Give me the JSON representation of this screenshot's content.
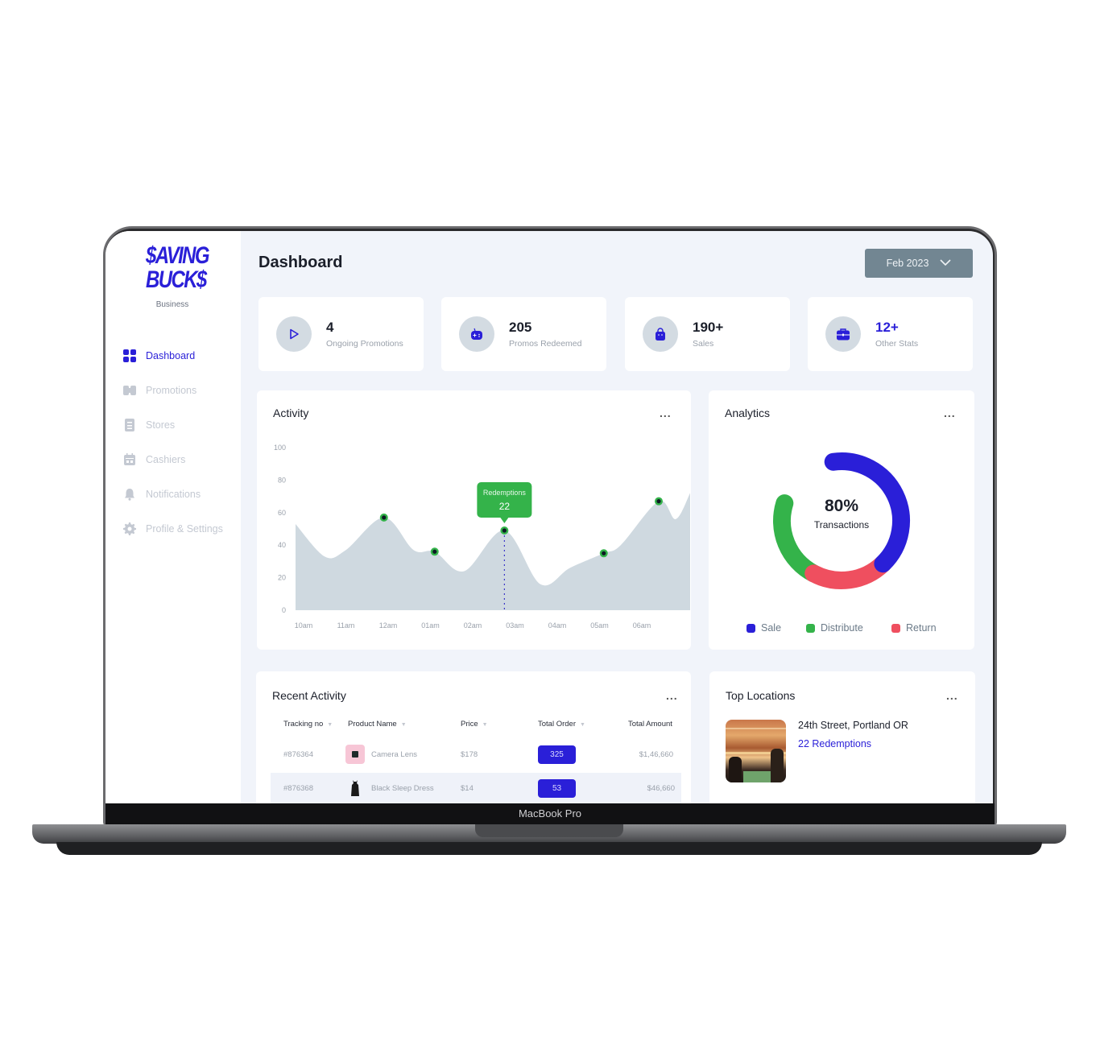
{
  "device": {
    "label": "MacBook Pro"
  },
  "brand": {
    "line1": "$AVING",
    "line2": "BUCK$",
    "subtitle": "Business",
    "color": "#2a1fd8"
  },
  "sidebar": {
    "items": [
      {
        "label": "Dashboard",
        "icon": "grid-icon",
        "active": true
      },
      {
        "label": "Promotions",
        "icon": "promotions-icon",
        "active": false
      },
      {
        "label": "Stores",
        "icon": "stores-icon",
        "active": false
      },
      {
        "label": "Cashiers",
        "icon": "calendar-icon",
        "active": false
      },
      {
        "label": "Notifications",
        "icon": "bell-icon",
        "active": false
      },
      {
        "label": "Profile & Settings",
        "icon": "gear-icon",
        "active": false
      }
    ]
  },
  "header": {
    "title": "Dashboard",
    "date_select": "Feb 2023"
  },
  "stats": [
    {
      "value": "4",
      "label": "Ongoing Promotions",
      "icon": "play-icon"
    },
    {
      "value": "205",
      "label": "Promos Redeemed",
      "icon": "gamepad-icon"
    },
    {
      "value": "190+",
      "label": "Sales",
      "icon": "bag-icon"
    },
    {
      "value": "12+",
      "label": "Other Stats",
      "icon": "briefcase-icon",
      "accent": true
    }
  ],
  "activity": {
    "title": "Activity",
    "more": "...",
    "tooltip": {
      "label": "Redemptions",
      "value": "22"
    }
  },
  "analytics": {
    "title": "Analytics",
    "more": "...",
    "center_value": "80%",
    "center_label": "Transactions",
    "legend": [
      {
        "label": "Sale",
        "color": "#2a1fd8"
      },
      {
        "label": "Distribute",
        "color": "#34b34a"
      },
      {
        "label": "Return",
        "color": "#ef4f5f"
      }
    ]
  },
  "recent_activity": {
    "title": "Recent Activity",
    "more": "...",
    "columns": [
      "Tracking no",
      "Product Name",
      "Price",
      "Total Order",
      "Total Amount"
    ],
    "rows": [
      {
        "tracking": "#876364",
        "product": "Camera Lens",
        "price": "$178",
        "orders": "325",
        "amount": "$1,46,660"
      },
      {
        "tracking": "#876368",
        "product": "Black Sleep Dress",
        "price": "$14",
        "orders": "53",
        "amount": "$46,660"
      }
    ]
  },
  "top_locations": {
    "title": "Top Locations",
    "more": "...",
    "items": [
      {
        "name": "24th Street, Portland OR",
        "redemptions": "22 Redemptions"
      }
    ]
  },
  "chart_data": [
    {
      "type": "area",
      "title": "Activity",
      "xlabel": "",
      "ylabel": "",
      "x": [
        "10am",
        "11am",
        "12am",
        "01am",
        "02am",
        "03am",
        "04am",
        "05am",
        "06am"
      ],
      "ylim": [
        0,
        100
      ],
      "yticks": [
        0,
        20,
        40,
        60,
        80,
        100
      ],
      "curve": [
        [
          -0.2,
          53
        ],
        [
          0.5,
          33
        ],
        [
          1.0,
          37
        ],
        [
          1.9,
          57
        ],
        [
          2.6,
          37
        ],
        [
          3.1,
          36
        ],
        [
          3.8,
          24
        ],
        [
          4.75,
          49
        ],
        [
          5.6,
          16
        ],
        [
          6.3,
          26
        ],
        [
          7.1,
          35
        ],
        [
          7.5,
          40
        ],
        [
          8.4,
          67
        ],
        [
          8.8,
          56
        ],
        [
          9.4,
          72
        ]
      ],
      "markers": [
        [
          1.9,
          57
        ],
        [
          3.1,
          36
        ],
        [
          4.75,
          49
        ],
        [
          7.1,
          35
        ],
        [
          8.4,
          67
        ]
      ],
      "highlight": {
        "x": 4.75,
        "label": "Redemptions",
        "value": 22
      },
      "fill_color": "#cfd9e0",
      "marker_color": "#34b34a"
    },
    {
      "type": "pie",
      "title": "Analytics",
      "center_label": "80% Transactions",
      "slices": [
        {
          "label": "Sale",
          "value": 40,
          "color": "#2a1fd8"
        },
        {
          "label": "Return",
          "value": 20,
          "color": "#ef4f5f"
        },
        {
          "label": "Distribute",
          "value": 22,
          "color": "#34b34a"
        }
      ]
    }
  ]
}
